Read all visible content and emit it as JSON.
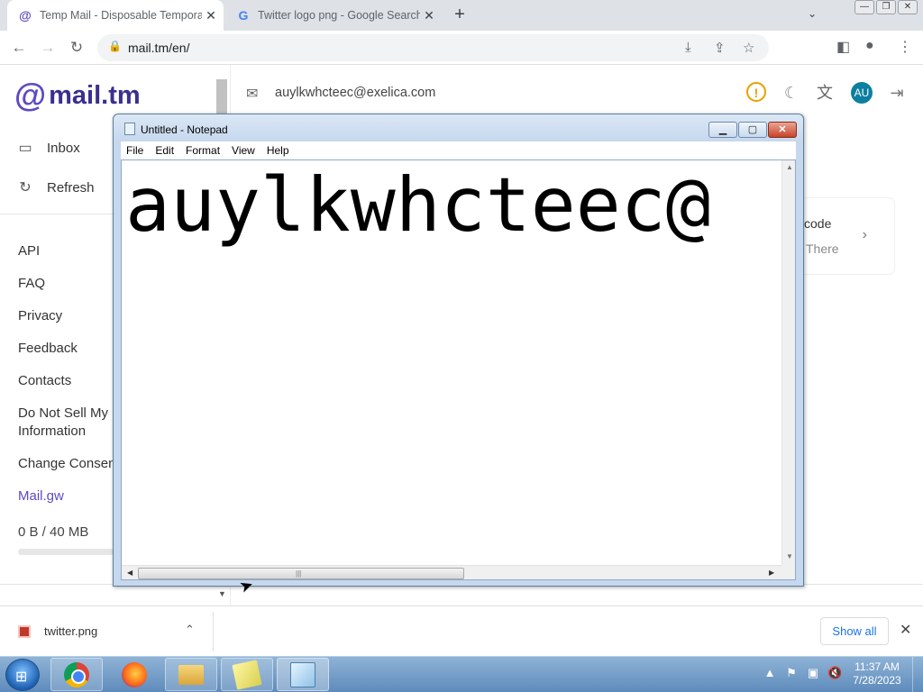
{
  "browser": {
    "tabs": [
      {
        "title": "Temp Mail - Disposable Tempora",
        "active": true,
        "favicon": "mail-tm-at-icon"
      },
      {
        "title": "Twitter logo png - Google Search",
        "active": false,
        "favicon": "google-g-icon"
      }
    ],
    "url": "mail.tm/en/"
  },
  "mailtm": {
    "logo_text": "mail.tm",
    "email": "auylkwhcteec@exelica.com",
    "avatar": "AU",
    "nav": {
      "inbox": "Inbox",
      "refresh": "Refresh"
    },
    "links": [
      "API",
      "FAQ",
      "Privacy",
      "Feedback",
      "Contacts",
      "Do Not Sell My P\nInformation",
      "Change Consen"
    ],
    "mailgw": "Mail.gw",
    "quota": "0 B  / 40 MB",
    "card": {
      "line1": "code",
      "line2": "There"
    }
  },
  "notepad": {
    "title": "Untitled - Notepad",
    "menu": [
      "File",
      "Edit",
      "Format",
      "View",
      "Help"
    ],
    "content": "auylkwhcteec@"
  },
  "downloads": {
    "file": "twitter.png",
    "show_all": "Show all"
  },
  "taskbar": {
    "time": "11:37 AM",
    "date": "7/28/2023"
  },
  "colors": {
    "accent": "#5b4bc4",
    "avatar_bg": "#0d7fa0",
    "warning": "#e6a100",
    "chrome_link": "#1a73e8"
  }
}
